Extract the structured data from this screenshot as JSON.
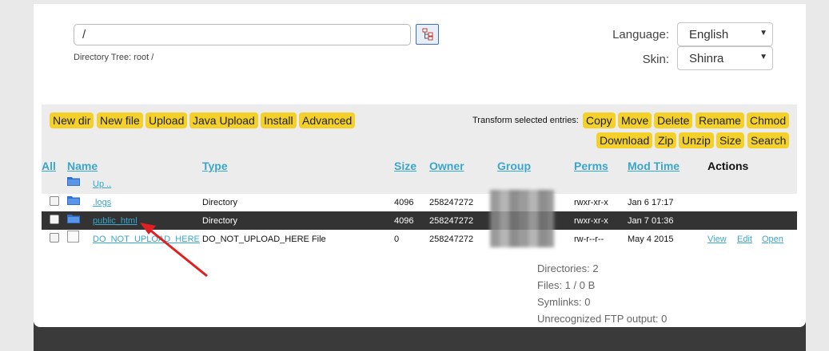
{
  "path": {
    "value": "/",
    "tree_label": "Directory Tree: root /"
  },
  "language": {
    "label": "Language:",
    "selected": "English"
  },
  "skin": {
    "label": "Skin:",
    "selected": "Shinra"
  },
  "toolbar": {
    "buttons": [
      "New dir",
      "New file",
      "Upload",
      "Java Upload",
      "Install",
      "Advanced"
    ],
    "transform_label": "Transform selected entries:",
    "actions_row1": [
      "Copy",
      "Move",
      "Delete",
      "Rename",
      "Chmod"
    ],
    "actions_row2": [
      "Download",
      "Zip",
      "Unzip",
      "Size",
      "Search"
    ]
  },
  "table": {
    "headers": {
      "all": "All",
      "name": "Name",
      "type": "Type",
      "size": "Size",
      "owner": "Owner",
      "group": "Group",
      "perms": "Perms",
      "mtime": "Mod Time",
      "actions": "Actions"
    },
    "up": "Up ..",
    "rows": [
      {
        "name": ".logs",
        "type": "Directory",
        "size": "4096",
        "owner": "258247272",
        "perms": "rwxr-xr-x",
        "mtime": "Jan 6 17:17"
      },
      {
        "name": "public_html",
        "type": "Directory",
        "size": "4096",
        "owner": "258247272",
        "perms": "rwxr-xr-x",
        "mtime": "Jan 7 01:36"
      },
      {
        "name": "DO_NOT_UPLOAD_HERE",
        "type": "DO_NOT_UPLOAD_HERE File",
        "size": "0",
        "owner": "258247272",
        "perms": "rw-r--r--",
        "mtime": "May 4 2015",
        "actions": [
          "View",
          "Edit",
          "Open"
        ]
      }
    ]
  },
  "stats": {
    "directories": "Directories: 2",
    "files": "Files: 1 / 0 B",
    "symlinks": "Symlinks: 0",
    "unrecognized": "Unrecognized FTP output: 0"
  },
  "colors": {
    "accent_button": "#f3d12a",
    "link": "#3aa6c9",
    "selected_row": "#333333",
    "annotation_arrow": "#e02020"
  }
}
